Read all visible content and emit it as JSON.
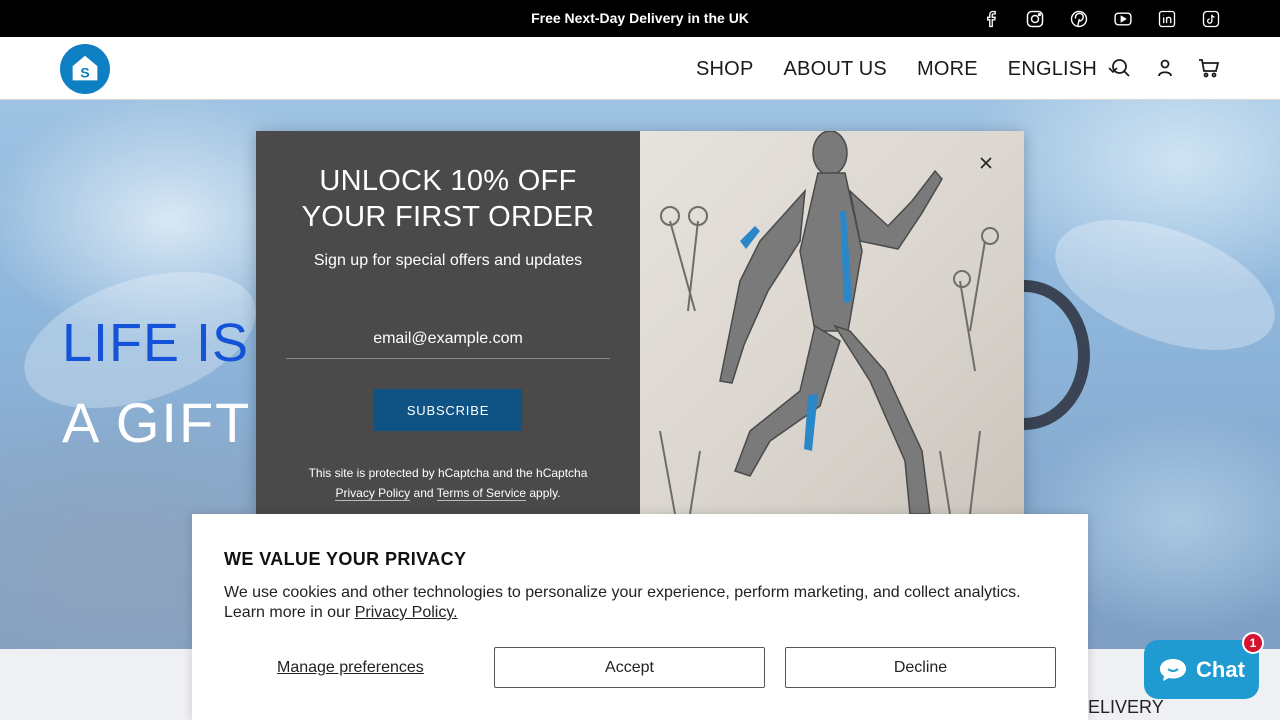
{
  "announcement": {
    "text": "Free Next-Day Delivery in the UK",
    "socials": [
      "facebook-icon",
      "instagram-icon",
      "pinterest-icon",
      "youtube-icon",
      "linkedin-icon",
      "tiktok-icon"
    ]
  },
  "header": {
    "nav": [
      {
        "label": "SHOP"
      },
      {
        "label": "ABOUT US"
      },
      {
        "label": "MORE"
      }
    ],
    "language": "ENGLISH",
    "icons": [
      "search-icon",
      "account-icon",
      "cart-icon"
    ]
  },
  "hero": {
    "line1": "LIFE IS",
    "line2": "A GIFT"
  },
  "strip": {
    "text": "ELIVERY"
  },
  "popup": {
    "title_line1": "UNLOCK 10% OFF",
    "title_line2": "YOUR FIRST ORDER",
    "subtitle": "Sign up for special offers and updates",
    "email_placeholder": "email@example.com",
    "button": "SUBSCRIBE",
    "legal_prefix": "This site is protected by hCaptcha and the hCaptcha",
    "privacy_link": "Privacy Policy",
    "and": "and",
    "terms_link": "Terms of Service",
    "suffix": "apply."
  },
  "cookie": {
    "title": "WE VALUE YOUR PRIVACY",
    "text": "We use cookies and other technologies to personalize your experience, perform marketing, and collect analytics. Learn more in our",
    "link": "Privacy Policy.",
    "manage": "Manage preferences",
    "accept": "Accept",
    "decline": "Decline"
  },
  "chat": {
    "label": "Chat",
    "badge": "1"
  },
  "colors": {
    "brand_blue": "#0f7fc4",
    "popup_bg": "#4a4a4a",
    "subscribe_bg": "#0e5384",
    "chat_bg": "#1f9bd1",
    "badge_red": "#d6142f"
  }
}
